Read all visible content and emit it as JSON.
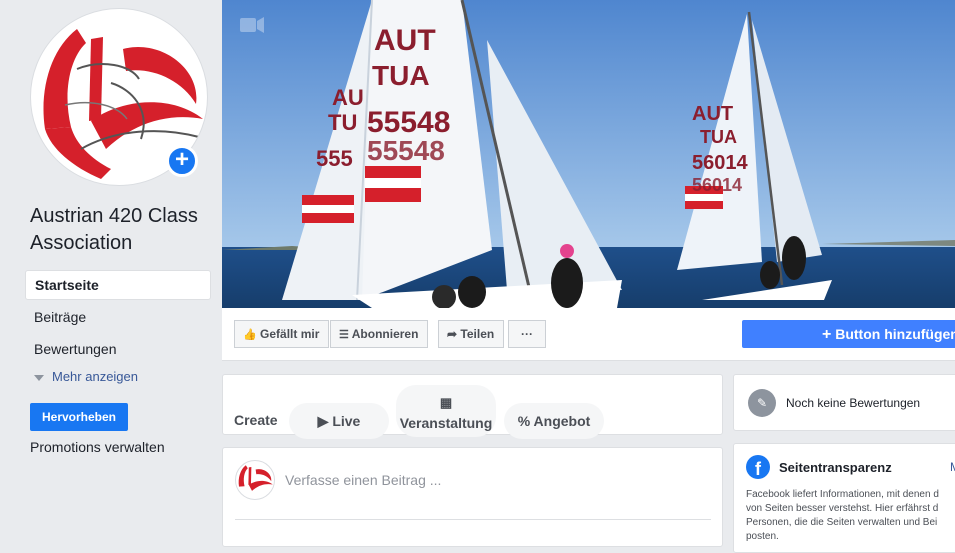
{
  "page": {
    "name": "Austrian 420 Class Association",
    "avatar_add_label": "+"
  },
  "sidebar": {
    "items": [
      {
        "label": "Startseite"
      },
      {
        "label": "Beiträge"
      },
      {
        "label": "Bewertungen"
      }
    ],
    "more_label": "Mehr anzeigen",
    "promote_label": "Hervorheben",
    "promotions_label": "Promotions verwalten"
  },
  "cover": {
    "sail_texts": [
      "AUT",
      "TUA",
      "55548",
      "55548",
      "AUT",
      "TUA",
      "56014",
      "56014",
      "AU",
      "TU",
      "555"
    ]
  },
  "actions": {
    "like_label": "Gefällt mir",
    "subscribe_label": "Abonnieren",
    "share_label": "Teilen",
    "more_label": "···",
    "add_button_label": "Button hinzufügen"
  },
  "create": {
    "label": "Create",
    "live_label": "Live",
    "event_label": "Veranstaltung",
    "offer_label": "Angebot"
  },
  "composer": {
    "placeholder": "Verfasse einen Beitrag ..."
  },
  "reviews": {
    "text": "Noch keine Bewertungen"
  },
  "transparency": {
    "title": "Seitentransparenz",
    "more_label": "M",
    "text_lines": [
      "Facebook liefert Informationen, mit denen d",
      "von Seiten besser verstehst. Hier erfährst d",
      "Personen, die die Seiten verwalten und Bei",
      "posten."
    ]
  },
  "colors": {
    "facebook_blue": "#1877f2",
    "button_blue": "#4080ff",
    "background": "#e9ebee",
    "link": "#385898",
    "logo_red": "#d5202b"
  }
}
